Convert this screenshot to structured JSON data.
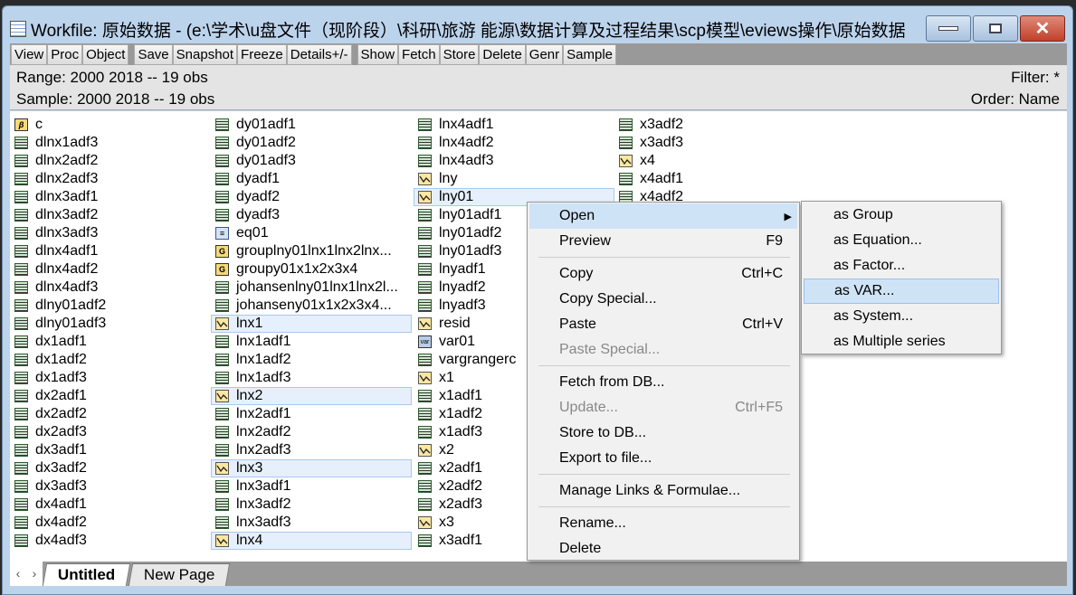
{
  "window": {
    "title": "Workfile: 原始数据 - (e:\\学术\\u盘文件（现阶段）\\科研\\旅游 能源\\数据计算及过程结果\\scp模型\\eviews操作\\原始数据.w...",
    "close": "✕"
  },
  "toolbar": [
    "View",
    "Proc",
    "Object",
    "|",
    "Save",
    "Snapshot",
    "Freeze",
    "Details+/-",
    "|",
    "Show",
    "Fetch",
    "Store",
    "Delete",
    "Genr",
    "Sample"
  ],
  "info": {
    "range": "Range:  2000 2018   --   19 obs",
    "sample": "Sample: 2000 2018   --   19 obs",
    "filter": "Filter: *",
    "order": "Order: Name"
  },
  "columns": [
    [
      [
        "coef",
        "c"
      ],
      [
        "table",
        "dlnx1adf3"
      ],
      [
        "table",
        "dlnx2adf2"
      ],
      [
        "table",
        "dlnx2adf3"
      ],
      [
        "table",
        "dlnx3adf1"
      ],
      [
        "table",
        "dlnx3adf2"
      ],
      [
        "table",
        "dlnx3adf3"
      ],
      [
        "table",
        "dlnx4adf1"
      ],
      [
        "table",
        "dlnx4adf2"
      ],
      [
        "table",
        "dlnx4adf3"
      ],
      [
        "table",
        "dlny01adf2"
      ],
      [
        "table",
        "dlny01adf3"
      ],
      [
        "table",
        "dx1adf1"
      ],
      [
        "table",
        "dx1adf2"
      ],
      [
        "table",
        "dx1adf3"
      ],
      [
        "table",
        "dx2adf1"
      ],
      [
        "table",
        "dx2adf2"
      ],
      [
        "table",
        "dx2adf3"
      ],
      [
        "table",
        "dx3adf1"
      ],
      [
        "table",
        "dx3adf2"
      ],
      [
        "table",
        "dx3adf3"
      ],
      [
        "table",
        "dx4adf1"
      ],
      [
        "table",
        "dx4adf2"
      ],
      [
        "table",
        "dx4adf3"
      ]
    ],
    [
      [
        "table",
        "dy01adf1"
      ],
      [
        "table",
        "dy01adf2"
      ],
      [
        "table",
        "dy01adf3"
      ],
      [
        "table",
        "dyadf1"
      ],
      [
        "table",
        "dyadf2"
      ],
      [
        "table",
        "dyadf3"
      ],
      [
        "equation",
        "eq01"
      ],
      [
        "group",
        "grouplny01lnx1lnx2lnx..."
      ],
      [
        "group",
        "groupy01x1x2x3x4"
      ],
      [
        "table",
        "johansenlny01lnx1lnx2l..."
      ],
      [
        "table",
        "johanseny01x1x2x3x4..."
      ],
      [
        "series",
        "lnx1",
        true
      ],
      [
        "table",
        "lnx1adf1"
      ],
      [
        "table",
        "lnx1adf2"
      ],
      [
        "table",
        "lnx1adf3"
      ],
      [
        "series",
        "lnx2",
        true
      ],
      [
        "table",
        "lnx2adf1"
      ],
      [
        "table",
        "lnx2adf2"
      ],
      [
        "table",
        "lnx2adf3"
      ],
      [
        "series",
        "lnx3",
        true
      ],
      [
        "table",
        "lnx3adf1"
      ],
      [
        "table",
        "lnx3adf2"
      ],
      [
        "table",
        "lnx3adf3"
      ],
      [
        "series",
        "lnx4",
        true
      ]
    ],
    [
      [
        "table",
        "lnx4adf1"
      ],
      [
        "table",
        "lnx4adf2"
      ],
      [
        "table",
        "lnx4adf3"
      ],
      [
        "series",
        "lny"
      ],
      [
        "series",
        "lny01",
        true
      ],
      [
        "table",
        "lny01adf1"
      ],
      [
        "table",
        "lny01adf2"
      ],
      [
        "table",
        "lny01adf3"
      ],
      [
        "table",
        "lnyadf1"
      ],
      [
        "table",
        "lnyadf2"
      ],
      [
        "table",
        "lnyadf3"
      ],
      [
        "series",
        "resid"
      ],
      [
        "var",
        "var01"
      ],
      [
        "table",
        "vargrangerc"
      ],
      [
        "series",
        "x1"
      ],
      [
        "table",
        "x1adf1"
      ],
      [
        "table",
        "x1adf2"
      ],
      [
        "table",
        "x1adf3"
      ],
      [
        "series",
        "x2"
      ],
      [
        "table",
        "x2adf1"
      ],
      [
        "table",
        "x2adf2"
      ],
      [
        "table",
        "x2adf3"
      ],
      [
        "series",
        "x3"
      ],
      [
        "table",
        "x3adf1"
      ]
    ],
    [
      [
        "table",
        "x3adf2"
      ],
      [
        "table",
        "x3adf3"
      ],
      [
        "series",
        "x4"
      ],
      [
        "table",
        "x4adf1"
      ],
      [
        "table",
        "x4adf2"
      ]
    ]
  ],
  "tabs": [
    "Untitled",
    "New Page"
  ],
  "context_menu": [
    {
      "label": "Open",
      "arrow": "▶",
      "hl": true
    },
    {
      "label": "Preview",
      "shortcut": "F9"
    },
    {
      "sep": true
    },
    {
      "label": "Copy",
      "shortcut": "Ctrl+C"
    },
    {
      "label": "Copy Special..."
    },
    {
      "label": "Paste",
      "shortcut": "Ctrl+V"
    },
    {
      "label": "Paste Special...",
      "disabled": true
    },
    {
      "sep": true
    },
    {
      "label": "Fetch from DB..."
    },
    {
      "label": "Update...",
      "shortcut": "Ctrl+F5",
      "disabled": true
    },
    {
      "label": "Store to DB..."
    },
    {
      "label": "Export to file..."
    },
    {
      "sep": true
    },
    {
      "label": "Manage Links & Formulae..."
    },
    {
      "sep": true
    },
    {
      "label": "Rename..."
    },
    {
      "label": "Delete"
    }
  ],
  "submenu": [
    {
      "label": "as Group"
    },
    {
      "label": "as Equation..."
    },
    {
      "label": "as Factor..."
    },
    {
      "label": "as VAR...",
      "hl": true
    },
    {
      "label": "as System..."
    },
    {
      "label": "as Multiple series"
    }
  ]
}
